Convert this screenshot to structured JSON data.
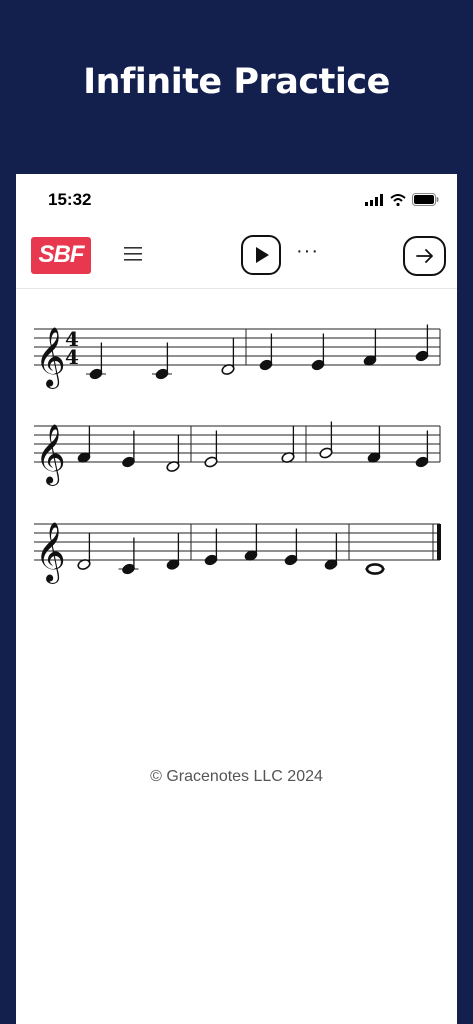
{
  "headline": "Infinite Practice",
  "status": {
    "time": "15:32"
  },
  "toolbar": {
    "logo_text": "SBF",
    "menu_icon": "hamburger-menu-icon",
    "play_icon": "play-icon",
    "more_text": "···",
    "next_icon": "arrow-right-icon"
  },
  "score": {
    "time_signature": {
      "beats": "4",
      "beat_type": "4"
    },
    "clef": "treble",
    "systems": [
      {
        "measures": [
          [
            {
              "pitch": "C4",
              "duration": "quarter"
            },
            {
              "pitch": "C4",
              "duration": "quarter"
            },
            {
              "pitch": "D4",
              "duration": "half"
            }
          ],
          [
            {
              "pitch": "E4",
              "duration": "quarter"
            },
            {
              "pitch": "E4",
              "duration": "quarter"
            },
            {
              "pitch": "F4",
              "duration": "quarter"
            },
            {
              "pitch": "G4",
              "duration": "quarter"
            }
          ]
        ]
      },
      {
        "measures": [
          [
            {
              "pitch": "F4",
              "duration": "quarter"
            },
            {
              "pitch": "E4",
              "duration": "quarter"
            },
            {
              "pitch": "D4",
              "duration": "half"
            }
          ],
          [
            {
              "pitch": "E4",
              "duration": "half"
            },
            {
              "pitch": "F4",
              "duration": "half"
            }
          ],
          [
            {
              "pitch": "G4",
              "duration": "half"
            },
            {
              "pitch": "F4",
              "duration": "quarter"
            },
            {
              "pitch": "E4",
              "duration": "quarter"
            }
          ]
        ]
      },
      {
        "measures": [
          [
            {
              "pitch": "D4",
              "duration": "half"
            },
            {
              "pitch": "C4",
              "duration": "quarter"
            },
            {
              "pitch": "D4",
              "duration": "quarter"
            }
          ],
          [
            {
              "pitch": "E4",
              "duration": "quarter"
            },
            {
              "pitch": "F4",
              "duration": "quarter"
            },
            {
              "pitch": "E4",
              "duration": "quarter"
            },
            {
              "pitch": "D4",
              "duration": "quarter"
            }
          ],
          [
            {
              "pitch": "C4",
              "duration": "whole"
            }
          ]
        ]
      }
    ]
  },
  "footer": {
    "copyright": "© Gracenotes LLC 2024"
  },
  "colors": {
    "background": "#131f4d",
    "logo": "#e8384f"
  }
}
